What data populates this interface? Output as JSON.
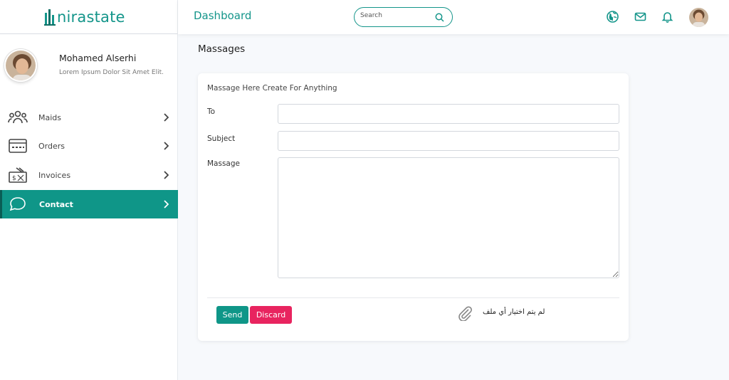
{
  "brand": {
    "name": "nirastate",
    "color": "#14958a"
  },
  "profile": {
    "name": "Mohamed Alserhi",
    "description": "Lorem Ipsum Dolor Sit Amet Elit."
  },
  "sidebar": {
    "items": [
      {
        "label": "Maids",
        "icon": "users-icon"
      },
      {
        "label": "Orders",
        "icon": "credit-card-icon"
      },
      {
        "label": "Invoices",
        "icon": "cash-icon"
      },
      {
        "label": "Contact",
        "icon": "chat-bubble-icon",
        "active": true
      }
    ]
  },
  "header": {
    "title": "Dashboard",
    "search": {
      "placeholder": "Search",
      "value": ""
    },
    "icons": [
      "globe-icon",
      "mail-icon",
      "bell-icon",
      "avatar"
    ]
  },
  "main": {
    "heading": "Massages",
    "form": {
      "title": "Massage Here Create For Anything",
      "to_label": "To",
      "to_value": "",
      "subject_label": "Subject",
      "subject_value": "",
      "message_label": "Massage",
      "message_value": "",
      "send_label": "Send",
      "discard_label": "Discard",
      "file_status": "لم يتم اختيار أي ملف"
    }
  },
  "colors": {
    "accent": "#0f9688",
    "danger": "#e8245f",
    "active_border": "#0a5d55"
  }
}
